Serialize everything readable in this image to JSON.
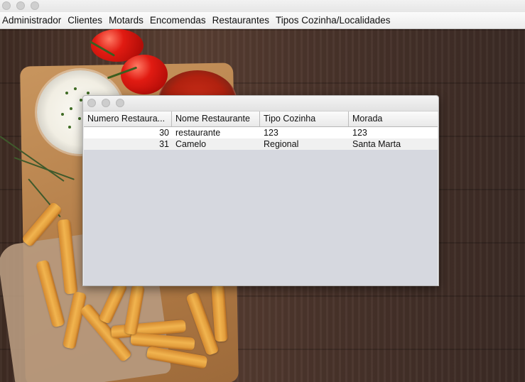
{
  "menu": {
    "items": [
      "Administrador",
      "Clientes",
      "Motards",
      "Encomendas",
      "Restaurantes",
      "Tipos Cozinha/Localidades"
    ]
  },
  "table": {
    "columns": [
      "Numero Restaura...",
      "Nome Restaurante",
      "Tipo Cozinha",
      "Morada"
    ],
    "rows": [
      [
        "30",
        "restaurante",
        "123",
        "123"
      ],
      [
        "31",
        "Camelo",
        "Regional",
        "Santa Marta"
      ]
    ]
  },
  "colors": {
    "table_background": "#d6d8df",
    "row_even": "#ffffff",
    "row_odd": "#f0f0f0"
  }
}
